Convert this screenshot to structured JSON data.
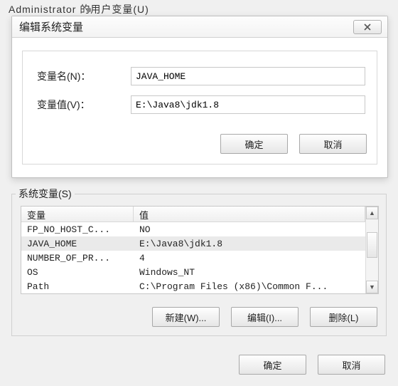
{
  "background": {
    "partial_text": "Administrator 的用户变量(U)"
  },
  "dialog": {
    "title": "编辑系统变量",
    "name_label": "变量名(N)：",
    "value_label": "变量值(V)：",
    "name_value": "JAVA_HOME",
    "value_value": "E:\\Java8\\jdk1.8",
    "ok_label": "确定",
    "cancel_label": "取消"
  },
  "system_vars": {
    "section_label": "系统变量(S)",
    "columns": {
      "name": "变量",
      "value": "值"
    },
    "rows": [
      {
        "name": "FP_NO_HOST_C...",
        "value": "NO",
        "selected": false
      },
      {
        "name": "JAVA_HOME",
        "value": "E:\\Java8\\jdk1.8",
        "selected": true
      },
      {
        "name": "NUMBER_OF_PR...",
        "value": "4",
        "selected": false
      },
      {
        "name": "OS",
        "value": "Windows_NT",
        "selected": false
      },
      {
        "name": "Path",
        "value": "C:\\Program Files (x86)\\Common F...",
        "selected": false
      }
    ],
    "new_label": "新建(W)...",
    "edit_label": "编辑(I)...",
    "delete_label": "删除(L)"
  },
  "bottom": {
    "ok_label": "确定",
    "cancel_label": "取消"
  }
}
